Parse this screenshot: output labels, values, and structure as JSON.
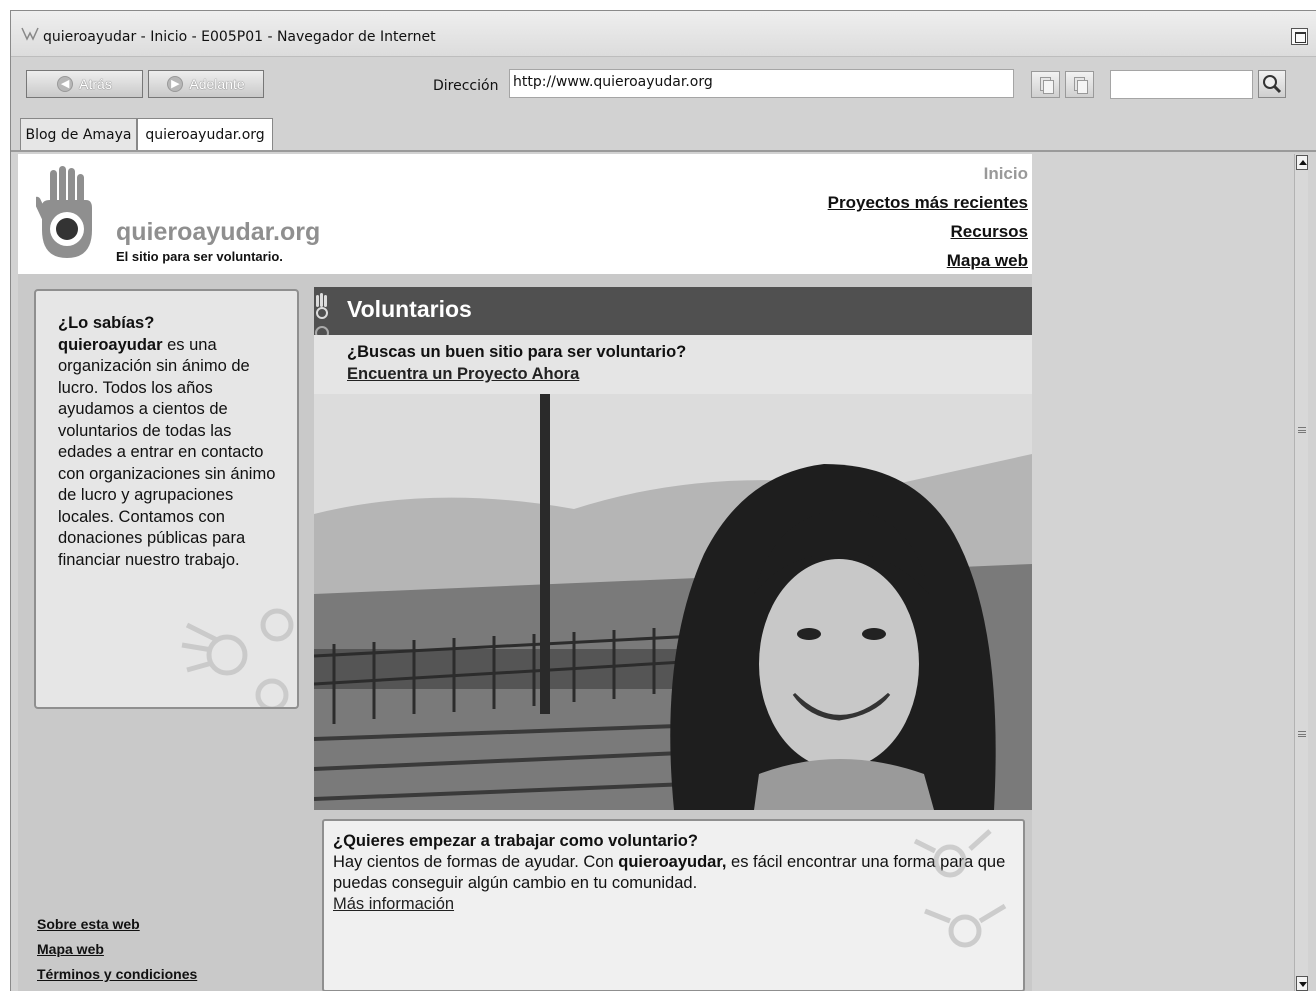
{
  "window": {
    "title": "quieroayudar - Inicio - E005P01 - Navegador de Internet"
  },
  "toolbar": {
    "back_label": "Atrás",
    "forward_label": "Adelante",
    "address_label": "Dirección",
    "address_value": "http://www.quieroayudar.org",
    "search_value": ""
  },
  "tabs": [
    {
      "label": "Blog de Amaya",
      "active": false
    },
    {
      "label": "quieroayudar.org",
      "active": true
    }
  ],
  "site": {
    "name": "quieroayudar.org",
    "tagline": "El sitio para ser voluntario.",
    "nav": [
      {
        "label": "Inicio",
        "current": true
      },
      {
        "label": "Proyectos más recientes",
        "current": false
      },
      {
        "label": "Recursos",
        "current": false
      },
      {
        "label": "Mapa web",
        "current": false
      }
    ]
  },
  "sidebar": {
    "heading": "¿Lo sabías?",
    "brand": "quieroayudar",
    "body": " es una organización sin ánimo de lucro. Todos los años ayudamos a cientos de voluntarios de todas las edades a entrar en contacto con organizaciones sin ánimo de lucro y agrupaciones locales. Contamos con donaciones públicas para financiar nuestro trabajo.",
    "footer_links": [
      "Sobre esta web",
      "Mapa web",
      "Términos y condiciones"
    ]
  },
  "main": {
    "section_title": "Voluntarios",
    "cta_question": "¿Buscas un buen sitio para ser voluntario?",
    "cta_link": "Encuentra un Proyecto Ahora",
    "promo_heading": "¿Quieres empezar a trabajar como voluntario?",
    "promo_text_1": "Hay cientos de formas de ayudar. Con ",
    "promo_brand": "quieroayudar,",
    "promo_text_2": " es fácil encontrar una forma para que puedas conseguir algún cambio en tu comunidad.",
    "promo_link": "Más información"
  },
  "colors": {
    "header_bar": "#505050",
    "page_bg": "#c9c9c9",
    "logo_gray": "#8f8f8f"
  }
}
